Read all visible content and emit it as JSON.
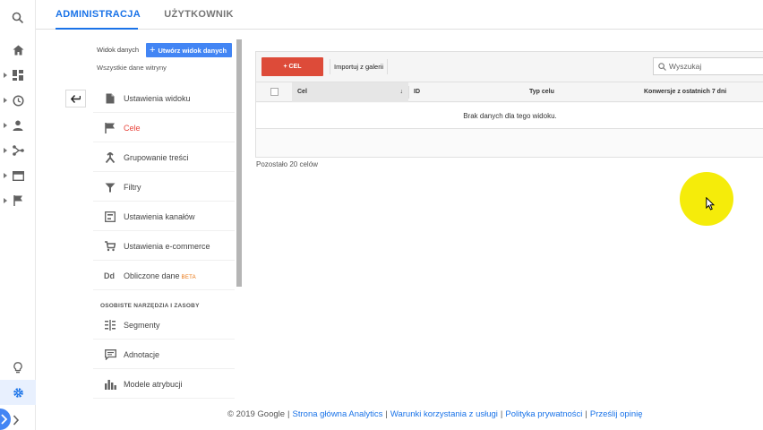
{
  "tabs": {
    "admin": "ADMINISTRACJA",
    "user": "UŻYTKOWNIK"
  },
  "view_panel": {
    "view_label": "Widok danych",
    "create_view": "Utwórz widok danych",
    "subtitle": "Wszystkie dane witryny",
    "items": [
      {
        "label": "Ustawienia widoku",
        "icon": "document-icon"
      },
      {
        "label": "Cele",
        "icon": "flag-icon",
        "active": true
      },
      {
        "label": "Grupowanie treści",
        "icon": "grouping-icon"
      },
      {
        "label": "Filtry",
        "icon": "filter-icon"
      },
      {
        "label": "Ustawienia kanałów",
        "icon": "channels-icon"
      },
      {
        "label": "Ustawienia e-commerce",
        "icon": "cart-icon"
      },
      {
        "label": "Obliczone dane",
        "icon": "calculated-metrics-icon",
        "badge": "BETA"
      }
    ],
    "section_heading": "OSOBISTE NARZĘDZIA I ZASOBY",
    "tools": [
      {
        "label": "Segmenty",
        "icon": "segments-icon"
      },
      {
        "label": "Adnotacje",
        "icon": "annotations-icon"
      },
      {
        "label": "Modele atrybucji",
        "icon": "attribution-icon"
      }
    ]
  },
  "goals": {
    "add_goal": "+ CEL",
    "import_gallery": "Importuj z galerii",
    "search_placeholder": "Wyszukaj",
    "columns": {
      "goal": "Cel",
      "id": "ID",
      "type": "Typ celu",
      "conversions": "Konwersje z ostatnich 7 dni"
    },
    "empty_message": "Brak danych dla tego widoku.",
    "remaining": "Pozostało 20 celów"
  },
  "footer": {
    "copyright": "© 2019 Google",
    "links": [
      "Strona główna Analytics",
      "Warunki korzystania z usługi",
      "Polityka prywatności",
      "Prześlij opinię"
    ]
  },
  "colors": {
    "accent_blue": "#1a73e8",
    "create_button": "#4285f4",
    "add_goal_red": "#dd4b39",
    "active_red": "#e8453c",
    "cursor_highlight": "#f5ec0a"
  },
  "rail_icons": [
    "search-icon",
    "home-icon",
    "dashboard-icon",
    "clock-icon",
    "person-icon",
    "acquisition-icon",
    "behavior-icon",
    "flag-icon",
    "lightbulb-icon",
    "gear-icon"
  ]
}
